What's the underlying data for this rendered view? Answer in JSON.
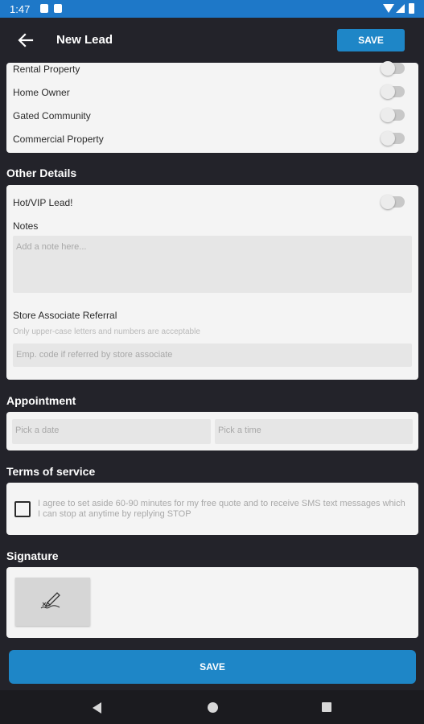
{
  "status_bar": {
    "time": "1:47"
  },
  "toolbar": {
    "title": "New Lead",
    "save_label": "SAVE"
  },
  "property": {
    "items": [
      {
        "label": "Rental Property",
        "on": false
      },
      {
        "label": "Home Owner",
        "on": false
      },
      {
        "label": "Gated Community",
        "on": false
      },
      {
        "label": "Commercial Property",
        "on": false
      }
    ]
  },
  "other_details": {
    "title": "Other Details",
    "hot_vip_label": "Hot/VIP Lead!",
    "notes_label": "Notes",
    "notes_placeholder": "Add a note here...",
    "referral_label": "Store Associate Referral",
    "referral_hint": "Only upper-case letters and numbers are acceptable",
    "referral_placeholder": "Emp. code if referred by store associate"
  },
  "appointment": {
    "title": "Appointment",
    "date_placeholder": "Pick a date",
    "time_placeholder": "Pick a time"
  },
  "terms": {
    "title": "Terms of service",
    "text": "I agree to set aside 60-90 minutes for my free quote and to receive SMS text messages which I can stop at anytime by replying STOP",
    "checked": false
  },
  "signature": {
    "title": "Signature"
  },
  "footer": {
    "save_label": "SAVE"
  },
  "colors": {
    "accent": "#1e86c7",
    "status_bar": "#1e78c8",
    "background": "#23232a"
  }
}
